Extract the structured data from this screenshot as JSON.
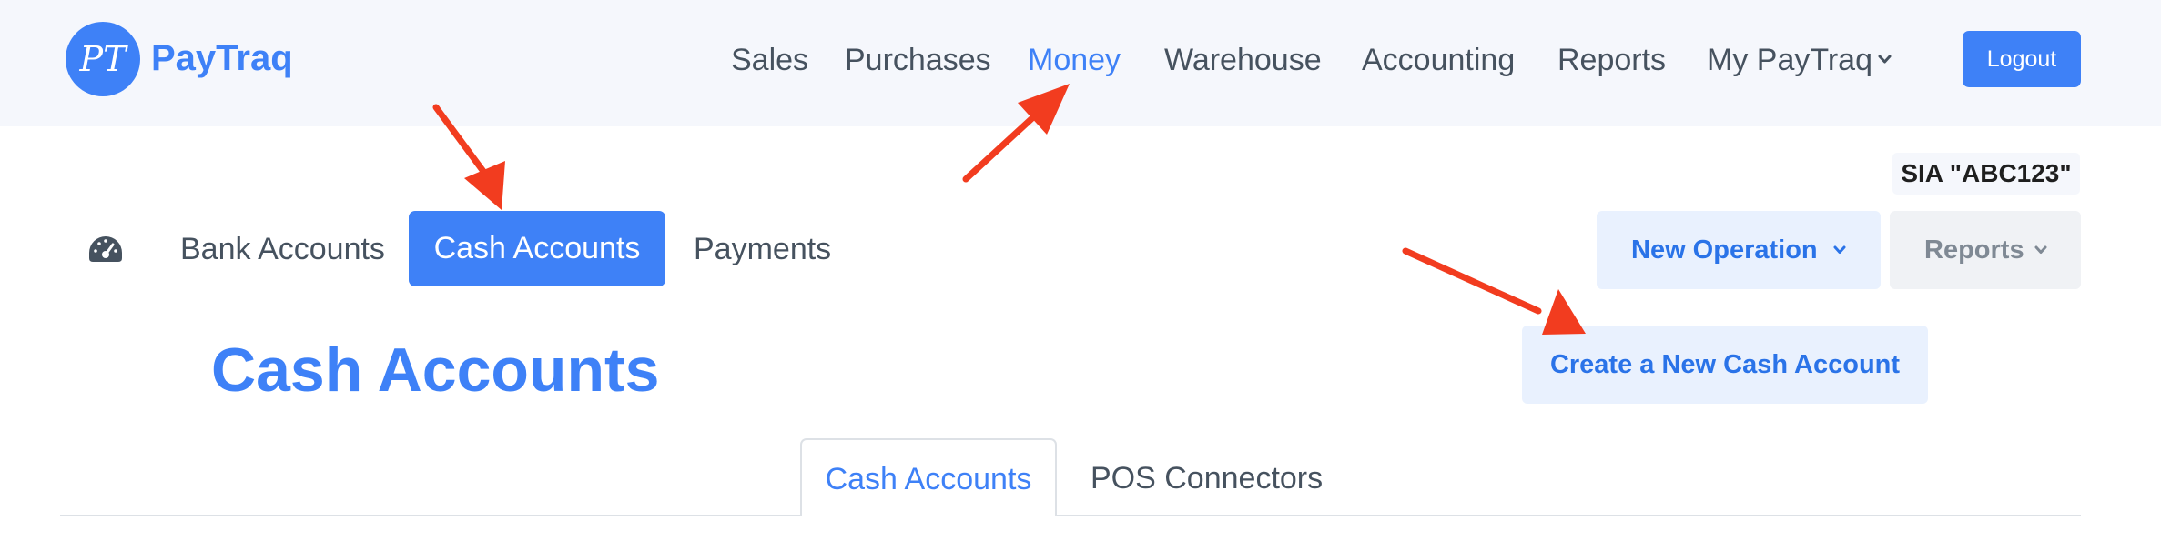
{
  "app": {
    "logo_initials": "PT",
    "logo_text": "PayTraq"
  },
  "nav": {
    "items": [
      {
        "label": "Sales"
      },
      {
        "label": "Purchases"
      },
      {
        "label": "Money",
        "active": true
      },
      {
        "label": "Warehouse"
      },
      {
        "label": "Accounting"
      },
      {
        "label": "Reports"
      },
      {
        "label": "My PayTraq",
        "has_dropdown": true
      }
    ],
    "logout_label": "Logout"
  },
  "company": {
    "name": "SIA \"ABC123\""
  },
  "subnav": {
    "dashboard_icon": "speedometer-icon",
    "items": [
      {
        "label": "Bank Accounts"
      },
      {
        "label": "Cash Accounts",
        "active": true
      },
      {
        "label": "Payments"
      }
    ]
  },
  "actions": {
    "new_operation_label": "New Operation",
    "reports_label": "Reports",
    "create_label": "Create a New Cash Account"
  },
  "page": {
    "title": "Cash Accounts"
  },
  "tabs": [
    {
      "label": "Cash Accounts",
      "active": true
    },
    {
      "label": "POS Connectors"
    }
  ],
  "colors": {
    "accent": "#3e81f7",
    "header_bg": "#f5f7fc",
    "annotation_arrow": "#f23c1f"
  }
}
